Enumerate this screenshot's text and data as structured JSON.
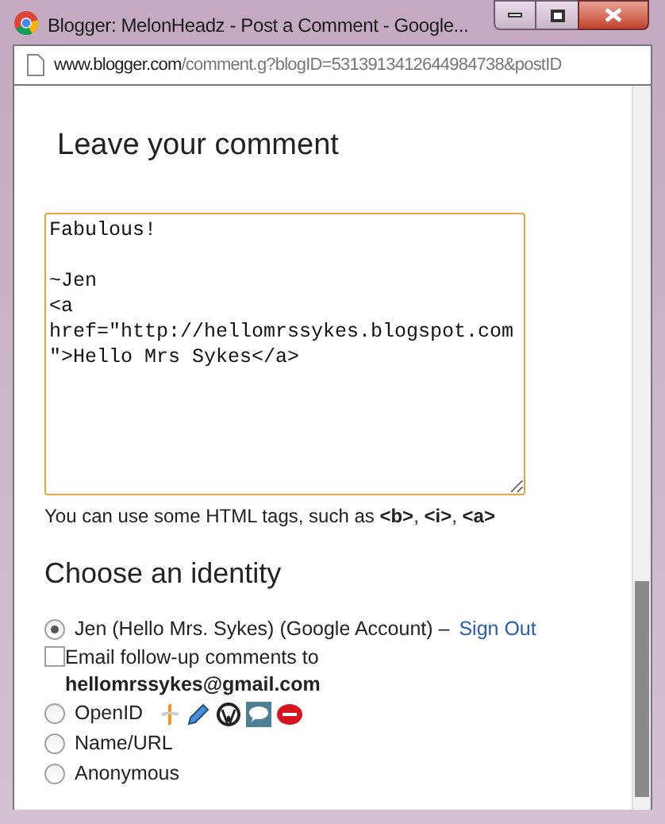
{
  "window": {
    "title": "Blogger: MelonHeadz - Post a Comment - Google..."
  },
  "address_bar": {
    "domain": "www.blogger.com",
    "path": "/comment.g?blogID=5313913412644984738&postID"
  },
  "heading": "Leave your comment",
  "comment": {
    "value": "Fabulous!\n\n~Jen\n<a href=\"http://hellomrssykes.blogspot.com\">Hello Mrs Sykes</a>"
  },
  "hint": "You can use some HTML tags, such as **<b>**, **<i>**, **<a>**",
  "identity": {
    "heading": "Choose an identity",
    "options": [
      {
        "kind": "account",
        "label": "Jen (Hello Mrs. Sykes) (Google Account) –",
        "link": "Sign Out",
        "selected": true,
        "followup": {
          "label": "Email follow-up comments to",
          "email": "hellomrssykes@gmail.com",
          "checked": false
        }
      },
      {
        "kind": "openid",
        "label": "OpenID",
        "selected": false
      },
      {
        "kind": "plain",
        "label": "Name/URL",
        "selected": false
      },
      {
        "kind": "plain",
        "label": "Anonymous",
        "selected": false
      }
    ]
  }
}
